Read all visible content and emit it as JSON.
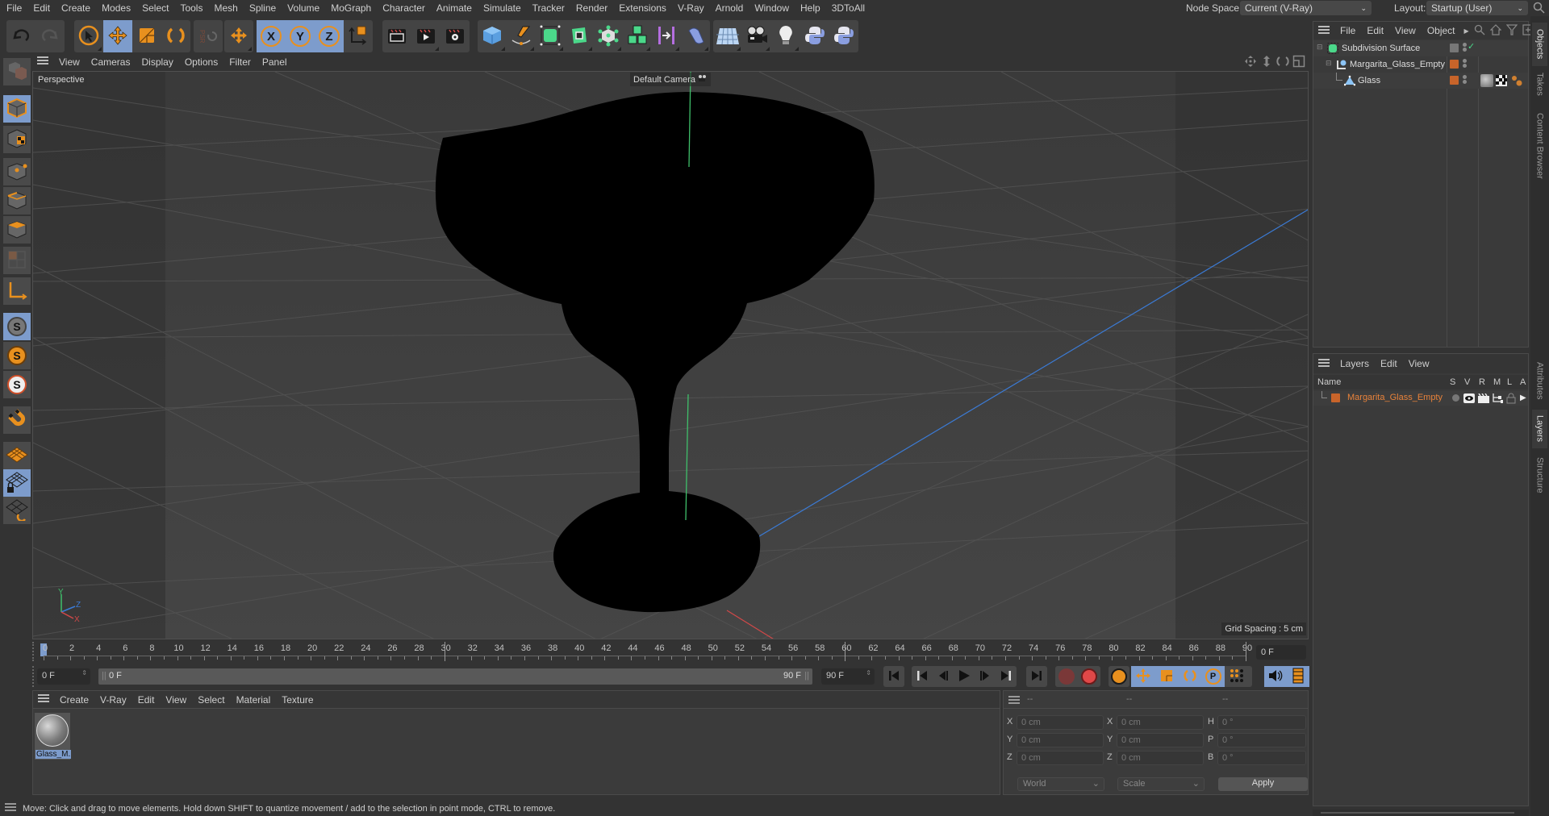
{
  "menubar": {
    "items": [
      "File",
      "Edit",
      "Create",
      "Modes",
      "Select",
      "Tools",
      "Mesh",
      "Spline",
      "Volume",
      "MoGraph",
      "Character",
      "Animate",
      "Simulate",
      "Tracker",
      "Render",
      "Extensions",
      "V-Ray",
      "Arnold",
      "Window",
      "Help",
      "3DToAll"
    ],
    "node_space_label": "Node Space:",
    "node_space_value": "Current (V-Ray)",
    "layout_label": "Layout:",
    "layout_value": "Startup (User)"
  },
  "toolbar": {
    "history": [
      "undo-icon",
      "redo-icon"
    ],
    "transform": [
      "live-selection-icon",
      "move-icon",
      "scale-icon",
      "rotate-icon"
    ],
    "psr": "PSR",
    "axis": [
      "X",
      "Y",
      "Z"
    ],
    "render": [
      "render-view-icon",
      "render-picture-viewer-icon",
      "render-settings-icon"
    ],
    "create": [
      "cube-icon",
      "pen-spline-icon",
      "subdivision-icon",
      "extrude-icon",
      "cloner-icon",
      "mograph-icon",
      "deformer-bend-icon",
      "field-icon"
    ],
    "scene": [
      "floor-icon",
      "camera-icon",
      "light-icon",
      "python-icon",
      "python-icon-2"
    ]
  },
  "left_toolbar": [
    "model-mode-icon",
    "object-mode-icon",
    "texture-mode-icon",
    "point-mode-icon",
    "edge-mode-icon",
    "polygon-mode-icon",
    "uv-mode-icon",
    "axis-mode-icon",
    "solo-icon",
    "solo-hierarchy-icon",
    "solo-selection-icon",
    "snap-icon",
    "workplane-icon",
    "locked-workplane-icon",
    "workplane-align-icon"
  ],
  "viewport": {
    "menu": [
      "View",
      "Cameras",
      "Display",
      "Options",
      "Filter",
      "Panel"
    ],
    "view_name": "Perspective",
    "camera_label": "Default Camera",
    "grid_spacing": "Grid Spacing : 5 cm",
    "axis_labels": {
      "y": "Y",
      "z": "Z",
      "x": "X"
    },
    "colors": {
      "y_axis": "#3fbf6a",
      "z_axis": "#3b7bd6",
      "x_axis": "#d04848",
      "object": "#000000"
    }
  },
  "timeline": {
    "ticks": [
      0,
      2,
      4,
      6,
      8,
      10,
      12,
      14,
      16,
      18,
      20,
      22,
      24,
      26,
      28,
      30,
      32,
      34,
      36,
      38,
      40,
      42,
      44,
      46,
      48,
      50,
      52,
      54,
      56,
      58,
      60,
      62,
      64,
      66,
      68,
      70,
      72,
      74,
      76,
      78,
      80,
      82,
      84,
      86,
      88,
      90
    ],
    "current_frame": "0 F",
    "start_field": "0 F",
    "range_start": "0 F",
    "range_end": "90 F",
    "end_field": "90 F",
    "max_frame": 90
  },
  "material_panel": {
    "menu": [
      "Create",
      "V-Ray",
      "Edit",
      "View",
      "Select",
      "Material",
      "Texture"
    ],
    "materials": [
      {
        "name": "Glass_M."
      }
    ]
  },
  "coord_panel": {
    "headers": [
      "--",
      "--",
      "--"
    ],
    "rows": [
      {
        "l1": "X",
        "v1": "0 cm",
        "l2": "X",
        "v2": "0 cm",
        "l3": "H",
        "v3": "0 °"
      },
      {
        "l1": "Y",
        "v1": "0 cm",
        "l2": "Y",
        "v2": "0 cm",
        "l3": "P",
        "v3": "0 °"
      },
      {
        "l1": "Z",
        "v1": "0 cm",
        "l2": "Z",
        "v2": "0 cm",
        "l3": "B",
        "v3": "0 °"
      }
    ],
    "coord_system": "World",
    "mode": "Scale",
    "apply_label": "Apply"
  },
  "status_bar": {
    "text": "Move: Click and drag to move elements. Hold down SHIFT to quantize movement / add to the selection in point mode, CTRL to remove."
  },
  "objects_panel": {
    "menu": [
      "File",
      "Edit",
      "View",
      "Object"
    ],
    "objects": [
      {
        "name": "Subdivision Surface",
        "icon": "subdivision-surface-icon"
      },
      {
        "name": "Margarita_Glass_Empty",
        "icon": "null-object-icon"
      },
      {
        "name": "Glass",
        "icon": "polygon-object-icon"
      }
    ]
  },
  "layers_panel": {
    "menu": [
      "Layers",
      "Edit",
      "View"
    ],
    "columns": [
      "Name",
      "S",
      "V",
      "R",
      "M",
      "L",
      "A"
    ],
    "layers": [
      {
        "name": "Margarita_Glass_Empty",
        "color": "#c8642a"
      }
    ]
  },
  "side_tabs": {
    "top": [
      "Objects",
      "Takes",
      "Content Browser"
    ],
    "bottom": [
      "Attributes",
      "Layers",
      "Structure"
    ]
  }
}
